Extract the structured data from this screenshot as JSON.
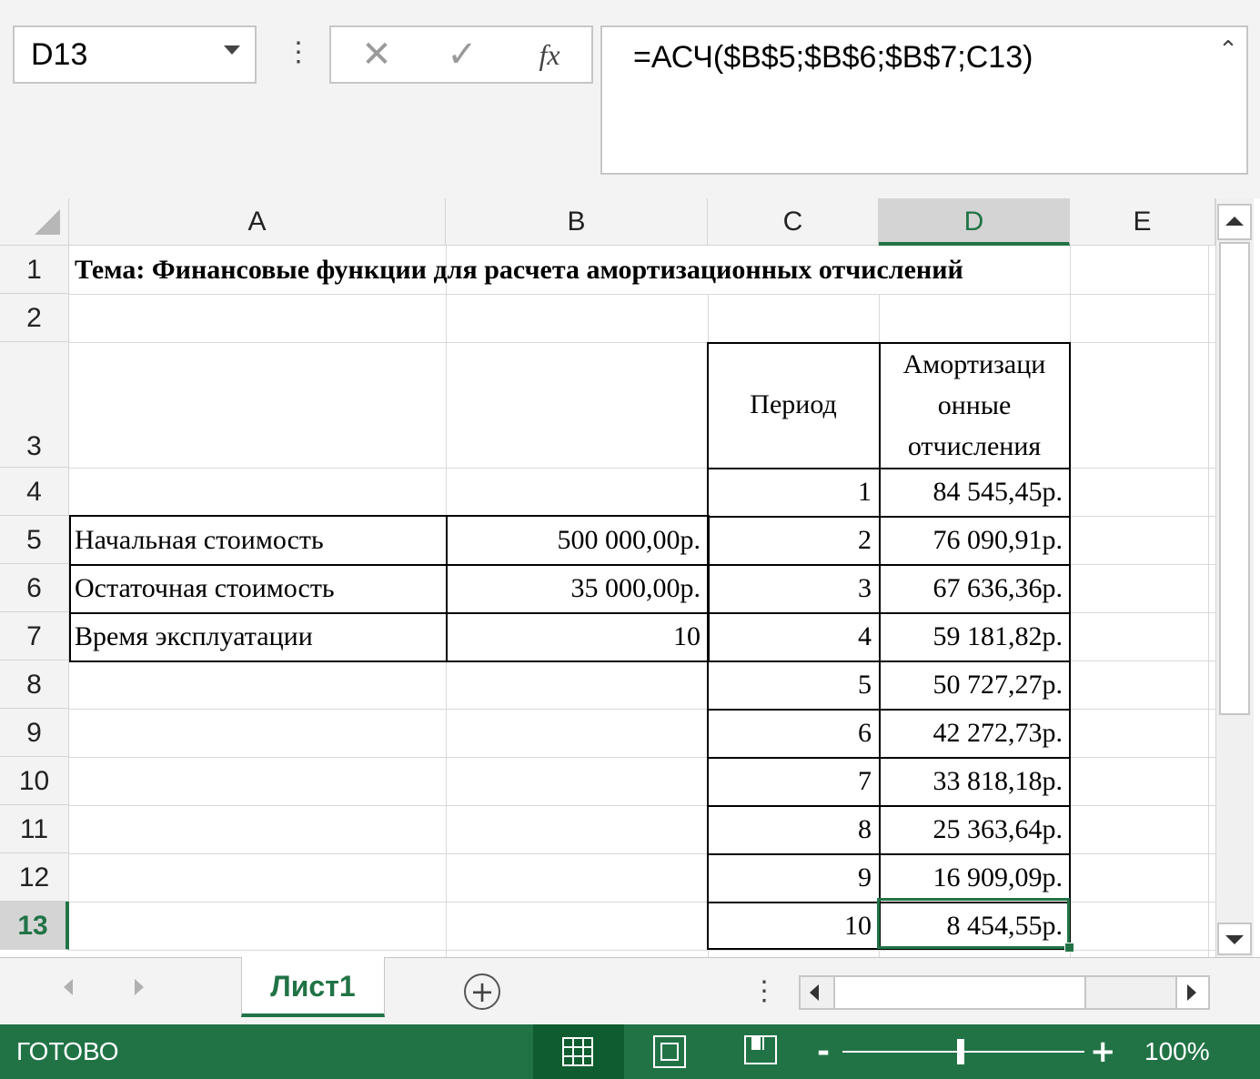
{
  "formula_bar": {
    "name_box": "D13",
    "cancel_glyph": "✕",
    "enter_glyph": "✓",
    "fx_label": "fx",
    "formula": "=АСЧ($B$5;$B$6;$B$7;C13)",
    "expand_glyph": "⌃",
    "more_glyph": "⋮"
  },
  "columns": [
    "A",
    "B",
    "C",
    "D",
    "E"
  ],
  "active_column": "D",
  "rows": [
    "1",
    "2",
    "3",
    "4",
    "5",
    "6",
    "7",
    "8",
    "9",
    "10",
    "11",
    "12",
    "13"
  ],
  "active_row": "13",
  "cells": {
    "A1": "Тема: Финансовые функции для расчета амортизационных отчислений",
    "C3": "Период",
    "D3_lines": [
      "Амортизаци",
      "онные",
      "отчисления"
    ],
    "A5": "Начальная стоимость",
    "B5": "500 000,00р.",
    "A6": "Остаточная стоимость",
    "B6": "35 000,00р.",
    "A7": "Время эксплуатации",
    "B7": "10",
    "periods": [
      "1",
      "2",
      "3",
      "4",
      "5",
      "6",
      "7",
      "8",
      "9",
      "10"
    ],
    "amortization": [
      "84 545,45р.",
      "76 090,91р.",
      "67 636,36р.",
      "59 181,82р.",
      "50 727,27р.",
      "42 272,73р.",
      "33 818,18р.",
      "25 363,64р.",
      "16 909,09р.",
      "8 454,55р."
    ]
  },
  "sheet_tabs": {
    "active": "Лист1",
    "add_glyph": "+",
    "more_glyph": "⋮"
  },
  "status_bar": {
    "status": "ГОТОВО",
    "zoom_minus": "-",
    "zoom_plus": "+",
    "zoom": "100%"
  },
  "colors": {
    "accent": "#217346"
  },
  "icons": [
    "dropdown-arrow-icon",
    "cancel-icon",
    "enter-icon",
    "function-icon",
    "expand-icon",
    "add-sheet-icon",
    "normal-view-icon",
    "page-layout-icon",
    "page-break-icon"
  ]
}
